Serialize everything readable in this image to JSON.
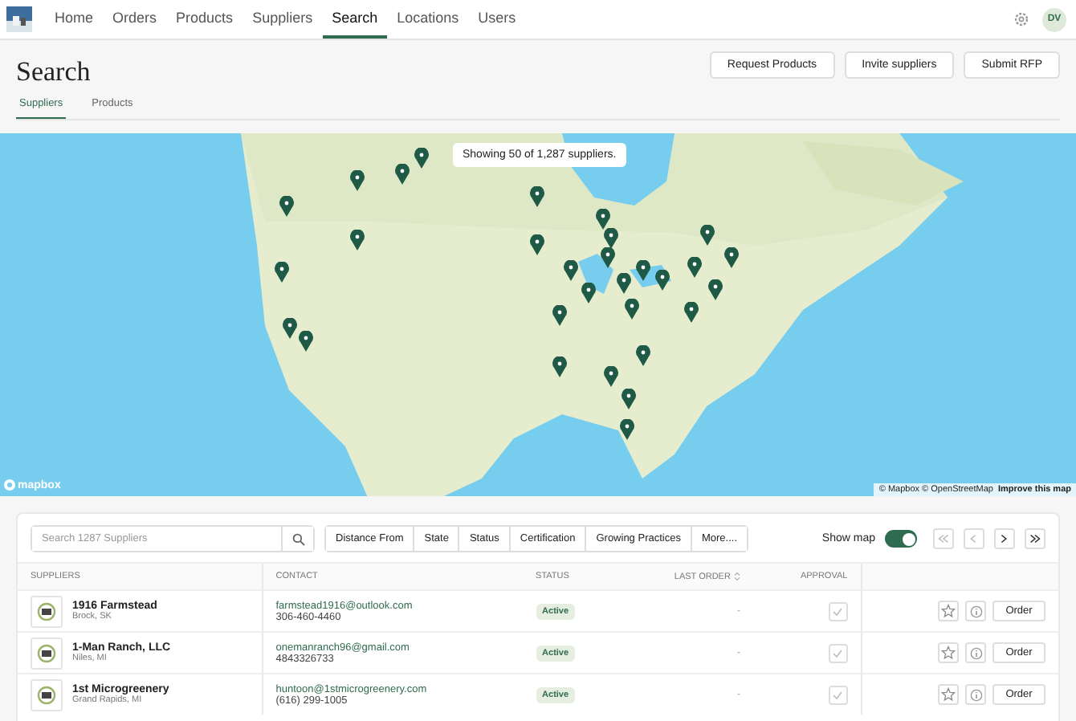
{
  "nav": {
    "items": [
      {
        "label": "Home",
        "selected": false
      },
      {
        "label": "Orders",
        "selected": false
      },
      {
        "label": "Products",
        "selected": false
      },
      {
        "label": "Suppliers",
        "selected": false
      },
      {
        "label": "Search",
        "selected": true
      },
      {
        "label": "Locations",
        "selected": false
      },
      {
        "label": "Users",
        "selected": false
      }
    ],
    "avatar": "DV"
  },
  "page": {
    "title": "Search",
    "actions": [
      "Request Products",
      "Invite suppliers",
      "Submit RFP"
    ],
    "tabs": [
      {
        "label": "Suppliers",
        "selected": true
      },
      {
        "label": "Products",
        "selected": false
      }
    ]
  },
  "map": {
    "summary": "Showing 50 of 1,287 suppliers.",
    "logo": "mapbox",
    "attribution": "© Mapbox © OpenStreetMap",
    "improve_link": "Improve this map"
  },
  "toolbar": {
    "search": {
      "placeholder": "Search 1287 Suppliers"
    },
    "filters": [
      "Distance From",
      "State",
      "Status",
      "Certification",
      "Growing Practices",
      "More...."
    ],
    "show_map": {
      "label": "Show map",
      "on": true
    }
  },
  "table": {
    "columns": [
      "SUPPLIERS",
      "CONTACT",
      "STATUS",
      "LAST ORDER",
      "APPROVAL"
    ],
    "rows": [
      {
        "name": "1916 Farmstead",
        "location": "Brock, SK",
        "email": "farmstead1916@outlook.com",
        "phone": "306-460-4460",
        "status": "Active",
        "last_order": "-",
        "favorite": false,
        "action": "Order"
      },
      {
        "name": "1-Man Ranch, LLC",
        "location": "Niles, MI",
        "email": "onemanranch96@gmail.com",
        "phone": "4843326733",
        "status": "Active",
        "last_order": "-",
        "favorite": false,
        "action": "Order"
      },
      {
        "name": "1st Microgreenery",
        "location": "Grand Rapids, MI",
        "email": "huntoon@1stmicrogreenery.com",
        "phone": "(616) 299-1005",
        "status": "Active",
        "last_order": "-",
        "favorite": false,
        "action": "Order"
      }
    ]
  }
}
